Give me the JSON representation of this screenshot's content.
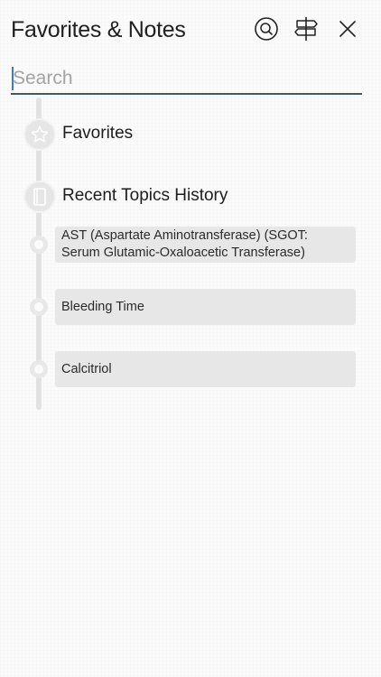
{
  "header": {
    "title": "Favorites & Notes",
    "search_icon": "search-icon",
    "signpost_icon": "signpost-icon",
    "close_icon": "close-icon"
  },
  "search": {
    "placeholder": "Search",
    "value": ""
  },
  "sections": {
    "favorites": {
      "label": "Favorites",
      "icon": "star-icon"
    },
    "recent": {
      "label": "Recent Topics History",
      "icon": "book-icon"
    }
  },
  "recent_topics": [
    {
      "label": "AST (Aspartate Aminotransferase) (SGOT: Serum Glutamic-Oxaloacetic Transferase)"
    },
    {
      "label": "Bleeding Time"
    },
    {
      "label": "Calcitriol"
    }
  ],
  "colors": {
    "search_underline": "#3e5a66",
    "caret": "#3c7bd4",
    "timeline": "#e2e2e2",
    "topic_background": "#e7e7e7"
  }
}
